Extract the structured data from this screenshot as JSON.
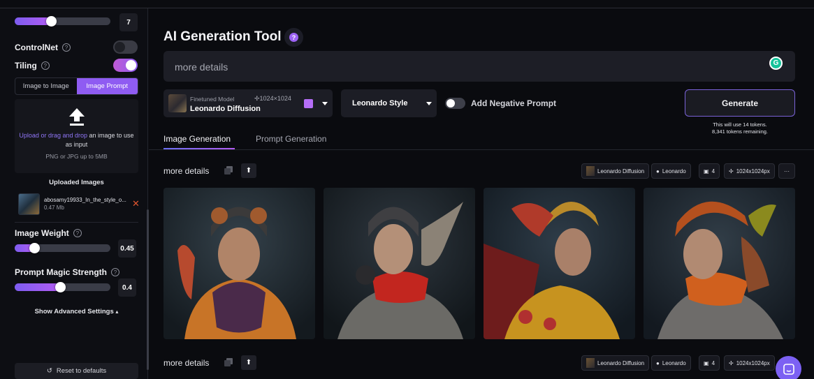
{
  "sidebar": {
    "top_slider_value": "7",
    "top_slider_fraction": 0.33,
    "controlnet_label": "ControlNet",
    "controlnet_on": false,
    "tiling_label": "Tiling",
    "tiling_on": true,
    "tab_image_to_image": "Image to Image",
    "tab_image_prompt": "Image Prompt",
    "upload_link": "Upload or drag and drop",
    "upload_rest": "an image to use as input",
    "upload_hint": "PNG or JPG up to 5MB",
    "uploaded_title": "Uploaded Images",
    "file_name": "abosamy19933_In_the_style_o...",
    "file_size": "0.47 Mb",
    "image_weight_label": "Image Weight",
    "image_weight_value": "0.45",
    "image_weight_fraction": 0.15,
    "prompt_magic_label": "Prompt Magic Strength",
    "prompt_magic_value": "0.4",
    "prompt_magic_fraction": 0.42,
    "advanced_label": "Show Advanced Settings",
    "reset_label": "Reset to defaults"
  },
  "header": {
    "title": "AI Generation Tool",
    "help": "?"
  },
  "prompt": {
    "value": "more details"
  },
  "model": {
    "kicker": "Finetuned Model",
    "dims": "1024×1024",
    "name": "Leonardo Diffusion"
  },
  "style": {
    "value": "Leonardo Style"
  },
  "negative_prompt_label": "Add Negative Prompt",
  "generate": {
    "label": "Generate",
    "tokens_line1": "This will use 14 tokens.",
    "tokens_line2": "8,341 tokens remaining."
  },
  "tabs": [
    {
      "label": "Image Generation",
      "active": true
    },
    {
      "label": "Prompt Generation",
      "active": false
    }
  ],
  "generations": [
    {
      "prompt": "more details",
      "model_chip": "Leonardo Diffusion",
      "style_chip": "Leonardo",
      "count_chip": "4",
      "size_chip": "1024x1024px",
      "more_chip": "···"
    },
    {
      "prompt": "more details",
      "model_chip": "Leonardo Diffusion",
      "style_chip": "Leonardo",
      "count_chip": "4",
      "size_chip": "1024x1024px"
    }
  ],
  "colors": {
    "accent": "#8f5cf2",
    "background": "#0b0c10",
    "panel": "#1c1d25"
  }
}
